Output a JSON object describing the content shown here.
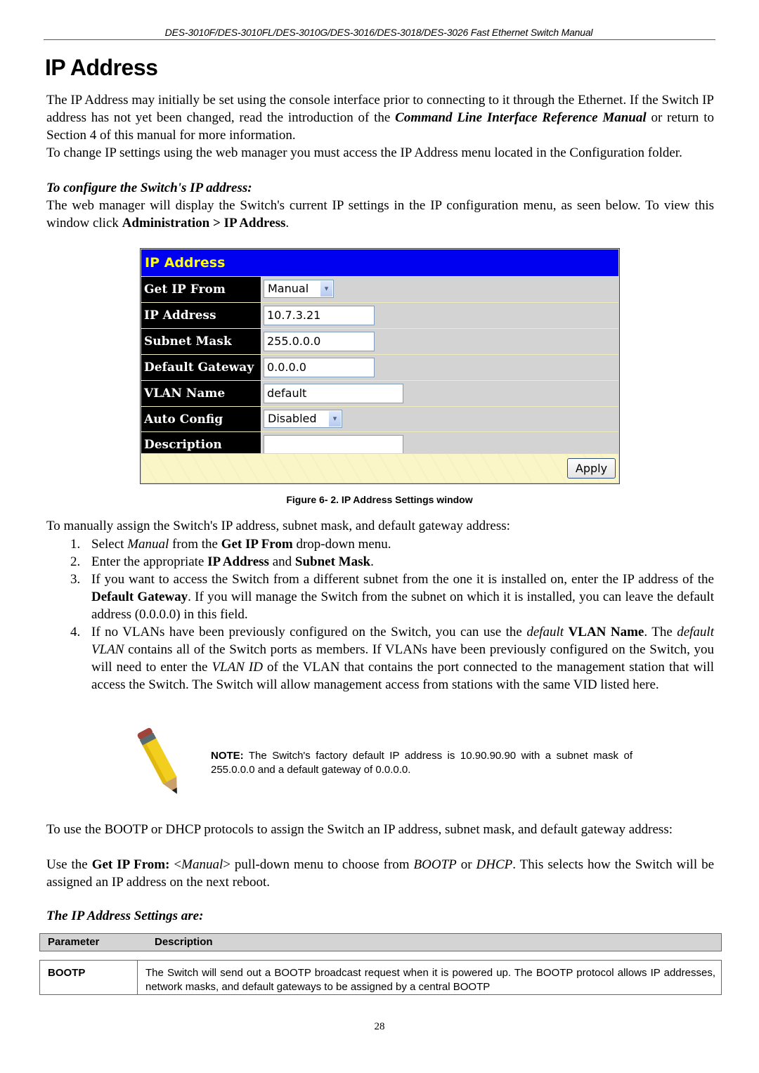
{
  "header": {
    "running_title": "DES-3010F/DES-3010FL/DES-3010G/DES-3016/DES-3018/DES-3026 Fast Ethernet Switch Manual"
  },
  "title": "IP Address",
  "intro": {
    "p1_a": "The IP Address may initially be set using the console interface prior to connecting to it through the Ethernet. If the Switch IP address has not yet been changed, read the introduction of the ",
    "p1_ref": "Command Line Interface Reference Manual",
    "p1_b": " or return to Section 4 of this manual for more information.",
    "p2": "To change IP settings using the web manager you must access the IP Address menu located in the Configuration folder.",
    "subheading": "To configure the Switch's IP address:",
    "p3_a": "The web manager will display the Switch's current IP settings in the IP configuration menu, as seen below. To view this window click ",
    "p3_path": "Administration > IP Address",
    "p3_b": "."
  },
  "screenshot": {
    "title": "IP Address",
    "fields": {
      "get_ip_from": {
        "label": "Get IP From",
        "value": "Manual"
      },
      "ip_address": {
        "label": "IP Address",
        "value": "10.7.3.21"
      },
      "subnet_mask": {
        "label": "Subnet Mask",
        "value": "255.0.0.0"
      },
      "default_gateway": {
        "label": "Default Gateway",
        "value": "0.0.0.0"
      },
      "vlan_name": {
        "label": "VLAN Name",
        "value": "default"
      },
      "auto_config_state": {
        "label": "Auto Config State",
        "value": "Disabled"
      },
      "description": {
        "label": "Description",
        "value": ""
      }
    },
    "apply_label": "Apply",
    "dropdown_arrow": "▾",
    "colors": {
      "title_bg": "#0000f0",
      "title_fg": "#ffff00",
      "label_bg": "#000000",
      "row_bg": "#d3d3d3",
      "footer_bg": "#fbf6c8"
    }
  },
  "figure_caption": "Figure 6- 2. IP Address Settings window",
  "manual_steps": {
    "lead": "To manually assign the Switch's IP address, subnet mask, and default gateway address:",
    "steps": [
      {
        "num": "1.",
        "a": "Select ",
        "i1": "Manual",
        "b": " from the ",
        "bold1": "Get IP From",
        "c": " drop-down menu."
      },
      {
        "num": "2.",
        "a": "Enter the appropriate ",
        "bold1": "IP Address",
        "b": " and ",
        "bold2": "Subnet Mask",
        "c": "."
      },
      {
        "num": "3.",
        "a": "If you want to access the Switch from a different subnet from the one it is installed on, enter the IP address of the ",
        "bold1": "Default Gateway",
        "b": ". If you will manage the Switch from the subnet on which it is installed, you can leave the default address (0.0.0.0) in this field."
      },
      {
        "num": "4.",
        "a": "If no VLANs have been previously configured on the Switch, you can use the ",
        "i1": "default",
        "b": " ",
        "bold1": "VLAN Name",
        "c": ". The ",
        "i2": "default VLAN",
        "d": " contains all of the Switch ports as members. If VLANs have been previously configured on the Switch, you will need to enter the ",
        "i3": "VLAN ID",
        "e": " of the VLAN that contains the port connected to the management station that will access the Switch. The Switch will allow management access from stations with the same VID listed here."
      }
    ]
  },
  "note": {
    "icon": "pencil-icon",
    "label": "NOTE:",
    "text": " The Switch's factory default IP address is 10.90.90.90 with a subnet mask of 255.0.0.0 and a default gateway of 0.0.0.0."
  },
  "bootp_dhcp": {
    "p1": "To use the BOOTP or DHCP protocols to assign the Switch an IP address, subnet mask, and default gateway address:",
    "p2_a": "Use the ",
    "p2_bold": "Get IP From:",
    "p2_b": " <",
    "p2_i1": "Manual",
    "p2_c": "> pull-down menu to choose from ",
    "p2_i2": "BOOTP",
    "p2_d": " or ",
    "p2_i3": "DHCP",
    "p2_e": ". This selects how the Switch will be assigned an IP address on the next reboot."
  },
  "settings": {
    "heading": "The IP Address Settings are:",
    "columns": [
      "Parameter",
      "Description"
    ],
    "rows": [
      {
        "parameter": "BOOTP",
        "description": "The Switch will send out a BOOTP broadcast request when it is powered up. The BOOTP protocol allows IP addresses, network masks, and default gateways to be assigned by a central BOOTP"
      }
    ]
  },
  "page_number": "28"
}
